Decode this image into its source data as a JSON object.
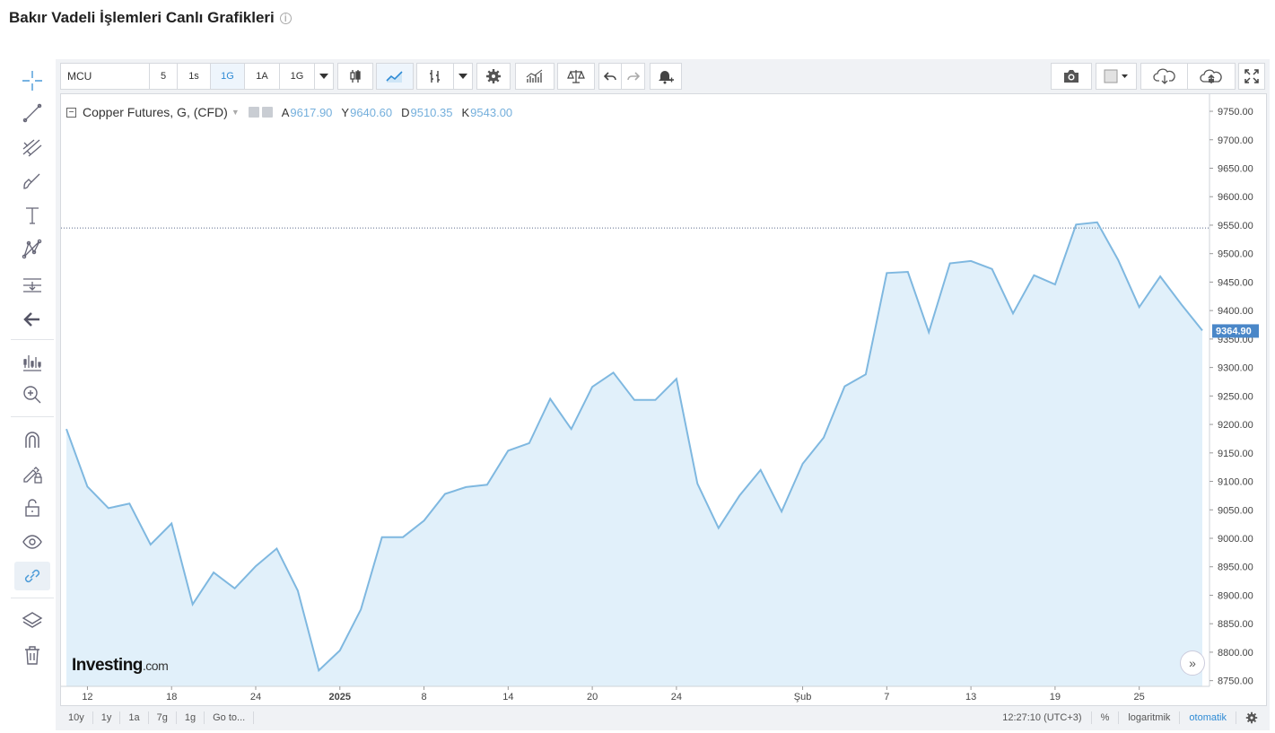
{
  "page": {
    "title": "Bakır Vadeli İşlemleri Canlı Grafikleri",
    "info_icon": "info-icon"
  },
  "toolbar": {
    "symbol": "MCU",
    "intervals": [
      "5",
      "1s",
      "1G",
      "1A",
      "1G"
    ],
    "active_interval_index": 2,
    "icons": [
      "candlestick-icon",
      "line-chart-icon",
      "bar-style-icon",
      "dropdown-icon",
      "settings-gear-icon",
      "indicators-icon",
      "compare-scale-icon",
      "undo-icon",
      "redo-icon",
      "alert-bell-icon",
      "camera-icon",
      "color-swatch-icon",
      "cloud-download-icon",
      "cloud-upload-icon",
      "fullscreen-icon"
    ]
  },
  "left_tools": [
    "crosshair-icon",
    "trend-line-icon",
    "pitchfork-icon",
    "brush-icon",
    "text-icon",
    "pattern-icon",
    "measure-icon",
    "back-arrow-icon",
    "ruler-icon",
    "zoom-icon",
    "magnet-icon",
    "lock-drawing-icon",
    "unlock-icon",
    "eye-icon",
    "link-icon",
    "layers-icon",
    "trash-icon"
  ],
  "legend": {
    "title": "Copper Futures, G, (CFD)",
    "open_key": "A",
    "open": "9617.90",
    "high_key": "Y",
    "high": "9640.60",
    "low_key": "D",
    "low": "9510.35",
    "close_key": "K",
    "close": "9543.00"
  },
  "logo": {
    "main": "Investing",
    "suffix": ".com"
  },
  "bottom": {
    "ranges": [
      "10y",
      "1y",
      "1a",
      "7g",
      "1g",
      "Go to..."
    ],
    "clock": "12:27:10 (UTC+3)",
    "percent": "%",
    "log": "logaritmik",
    "auto": "otomatik"
  },
  "colors": {
    "line": "#7fb8e0",
    "area": "#e1f0fa",
    "price_tag": "#4a87c8",
    "active": "#2f8bd5"
  },
  "chart_data": {
    "type": "area",
    "title": "Copper Futures, G, (CFD)",
    "ylim": [
      8740,
      9780
    ],
    "y_ticks": [
      "9750.00",
      "9700.00",
      "9650.00",
      "9600.00",
      "9550.00",
      "9500.00",
      "9450.00",
      "9400.00",
      "9350.00",
      "9300.00",
      "9250.00",
      "9200.00",
      "9150.00",
      "9100.00",
      "9050.00",
      "9000.00",
      "8950.00",
      "8900.00",
      "8850.00",
      "8800.00",
      "8750.00"
    ],
    "x_tick_labels": [
      "12",
      "18",
      "24",
      "2025",
      "8",
      "14",
      "20",
      "24",
      "Şub",
      "7",
      "13",
      "19",
      "25"
    ],
    "x_tick_index": [
      1,
      5,
      9,
      13,
      17,
      21,
      25,
      29,
      35,
      39,
      43,
      47,
      51
    ],
    "last_price": "9364.90",
    "dotted_level": 9545,
    "values": [
      9192,
      9091,
      9053,
      9061,
      8989,
      9026,
      8884,
      8940,
      8912,
      8951,
      8982,
      8908,
      8768,
      8803,
      8875,
      9002,
      9002,
      9031,
      9078,
      9090,
      9094,
      9154,
      9167,
      9245,
      9192,
      9266,
      9291,
      9243,
      9243,
      9280,
      9096,
      9018,
      9075,
      9120,
      9047,
      9131,
      9177,
      9267,
      9288,
      9466,
      9468,
      9362,
      9483,
      9487,
      9473,
      9395,
      9462,
      9446,
      9551,
      9555,
      9489,
      9406,
      9460,
      9411,
      9364.9
    ]
  }
}
